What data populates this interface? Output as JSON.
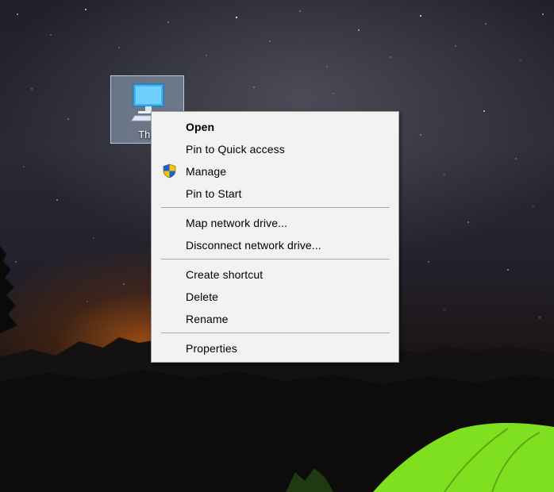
{
  "desktop": {
    "icon": {
      "label": "This",
      "icon": "computer-icon"
    }
  },
  "context_menu": {
    "groups": [
      [
        {
          "label": "Open",
          "bold": true
        },
        {
          "label": "Pin to Quick access"
        },
        {
          "label": "Manage",
          "icon": "uac-shield-icon"
        },
        {
          "label": "Pin to Start"
        }
      ],
      [
        {
          "label": "Map network drive..."
        },
        {
          "label": "Disconnect network drive..."
        }
      ],
      [
        {
          "label": "Create shortcut"
        },
        {
          "label": "Delete"
        },
        {
          "label": "Rename"
        }
      ],
      [
        {
          "label": "Properties"
        }
      ]
    ]
  },
  "colors": {
    "menu_background": "#f2f2f2",
    "menu_border": "#a0a0a0",
    "separator": "#a8a8a8",
    "selection_fill": "#b4cdeb",
    "tent_green": "#7fe020"
  }
}
